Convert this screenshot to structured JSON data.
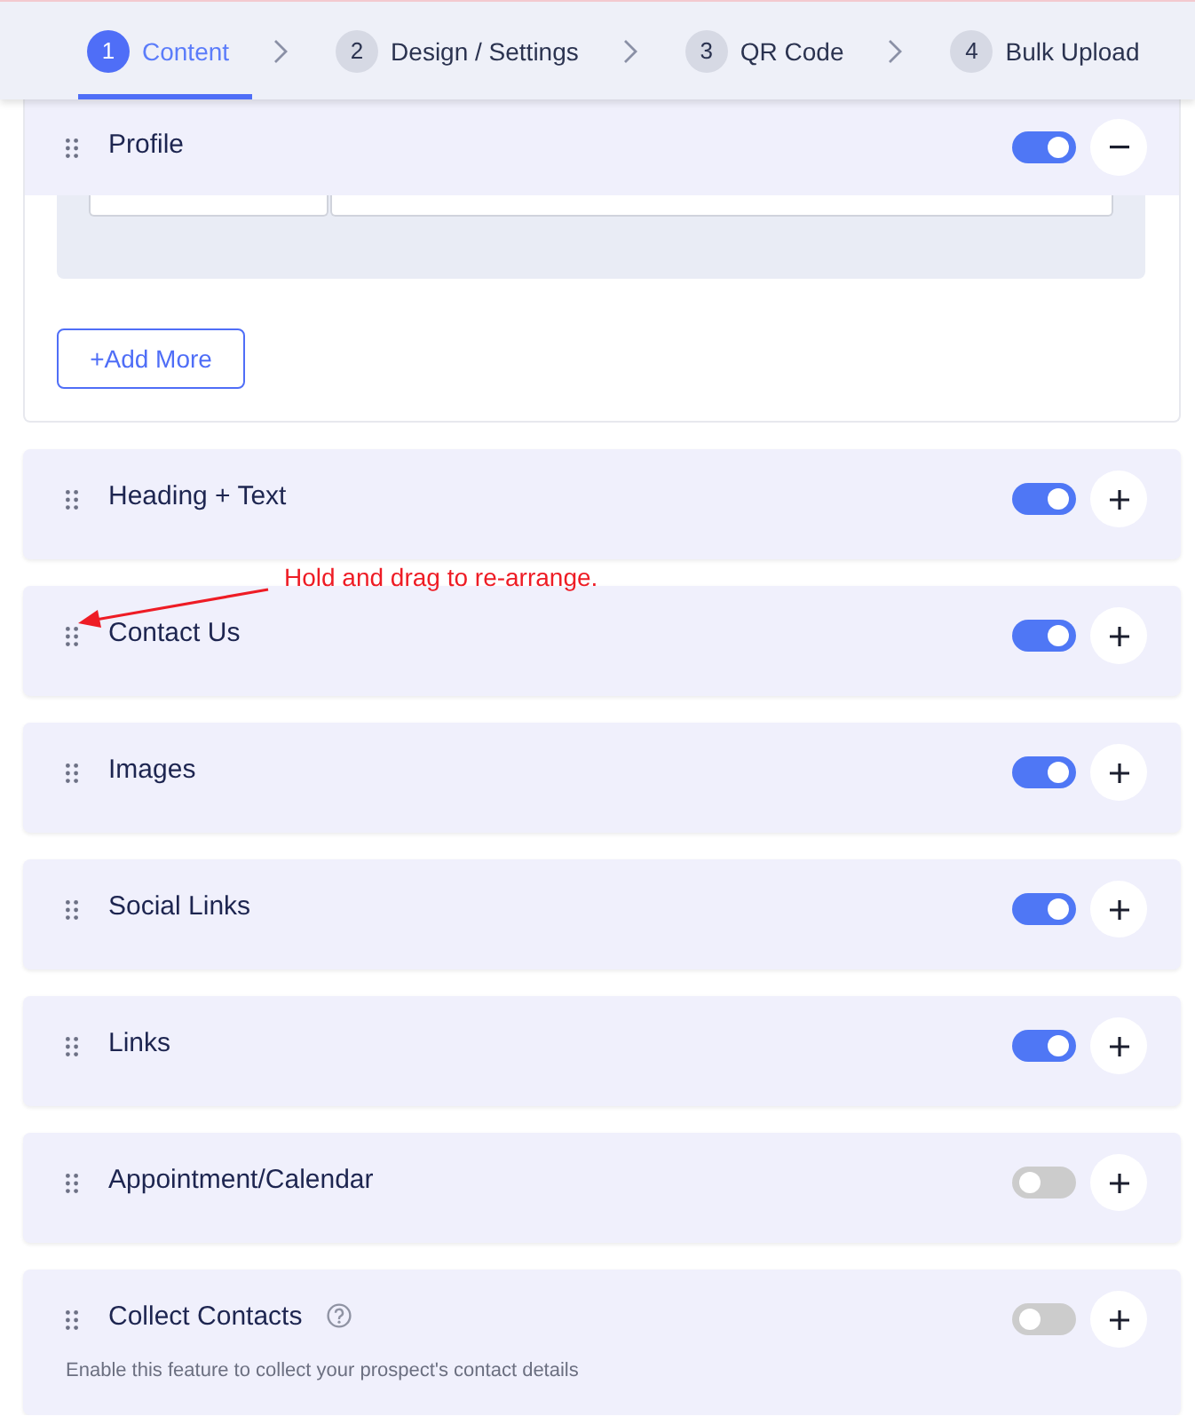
{
  "steps": [
    {
      "number": "1",
      "label": "Content",
      "selected": true
    },
    {
      "number": "2",
      "label": "Design / Settings",
      "selected": false
    },
    {
      "number": "3",
      "label": "QR Code",
      "selected": false
    },
    {
      "number": "4",
      "label": "Bulk Upload",
      "selected": false
    }
  ],
  "sections": [
    {
      "title": "Profile",
      "enabled": true,
      "expanded": true,
      "fields": [
        {
          "kind": "text"
        },
        {
          "kind": "text"
        }
      ],
      "add_button": "+Add More"
    },
    {
      "title": "Heading + Text",
      "enabled": true,
      "expanded": false
    },
    {
      "title": "Contact Us",
      "enabled": true,
      "expanded": false
    },
    {
      "title": "Images",
      "enabled": true,
      "expanded": false
    },
    {
      "title": "Social Links",
      "enabled": true,
      "expanded": false
    },
    {
      "title": "Links",
      "enabled": true,
      "expanded": false
    },
    {
      "title": "Appointment/Calendar",
      "enabled": false,
      "expanded": false
    },
    {
      "title": "Collect Contacts",
      "enabled": false,
      "expanded": false,
      "help": true,
      "description": "Enable this feature to collect your prospect's contact details"
    }
  ],
  "annotation": {
    "text": "Hold and drag to re-arrange."
  }
}
